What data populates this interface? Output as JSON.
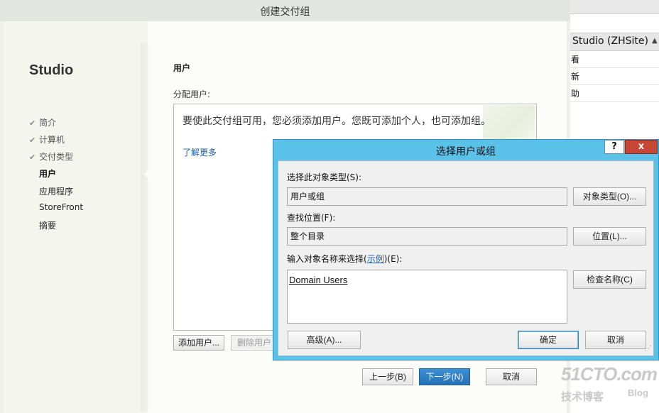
{
  "wizard": {
    "title": "创建交付组",
    "brand": "Studio",
    "nav": [
      {
        "label": "简介",
        "done": true
      },
      {
        "label": "计算机",
        "done": true
      },
      {
        "label": "交付类型",
        "done": true
      },
      {
        "label": "用户",
        "current": true
      },
      {
        "label": "应用程序"
      },
      {
        "label": "StoreFront"
      },
      {
        "label": "摘要"
      }
    ],
    "section_title": "用户",
    "assign_label": "分配用户:",
    "info_text": "要使此交付组可用，您必须添加用户。您既可添加个人，也可添加组。",
    "learn_more": "了解更多",
    "add_user": "添加用户...",
    "remove_user": "删除用户",
    "back": "上一步(B)",
    "next": "下一步(N)",
    "cancel": "取消"
  },
  "background_window": {
    "header": "Studio (ZHSite)",
    "header_arrow": "▲",
    "rows": [
      "看",
      "新",
      "助"
    ]
  },
  "dialog": {
    "title": "选择用户或组",
    "help": "?",
    "close": "x",
    "object_type_label": "选择此对象类型(S):",
    "object_type_value": "用户或组",
    "object_types_button": "对象类型(O)...",
    "location_label": "查找位置(F):",
    "location_value": "整个目录",
    "locations_button": "位置(L)...",
    "enter_names_label_prefix": "输入对象名称来选择(",
    "enter_names_link": "示例",
    "enter_names_label_suffix": ")(E):",
    "names_value": "Domain Users",
    "check_names_button": "检查名称(C)",
    "advanced_button": "高级(A)...",
    "ok_button": "确定",
    "cancel_button": "取消",
    "grip": "⋰"
  },
  "watermark": {
    "logo": "51CTO.com",
    "sub1": "技术博客",
    "sub2": "Blog"
  }
}
